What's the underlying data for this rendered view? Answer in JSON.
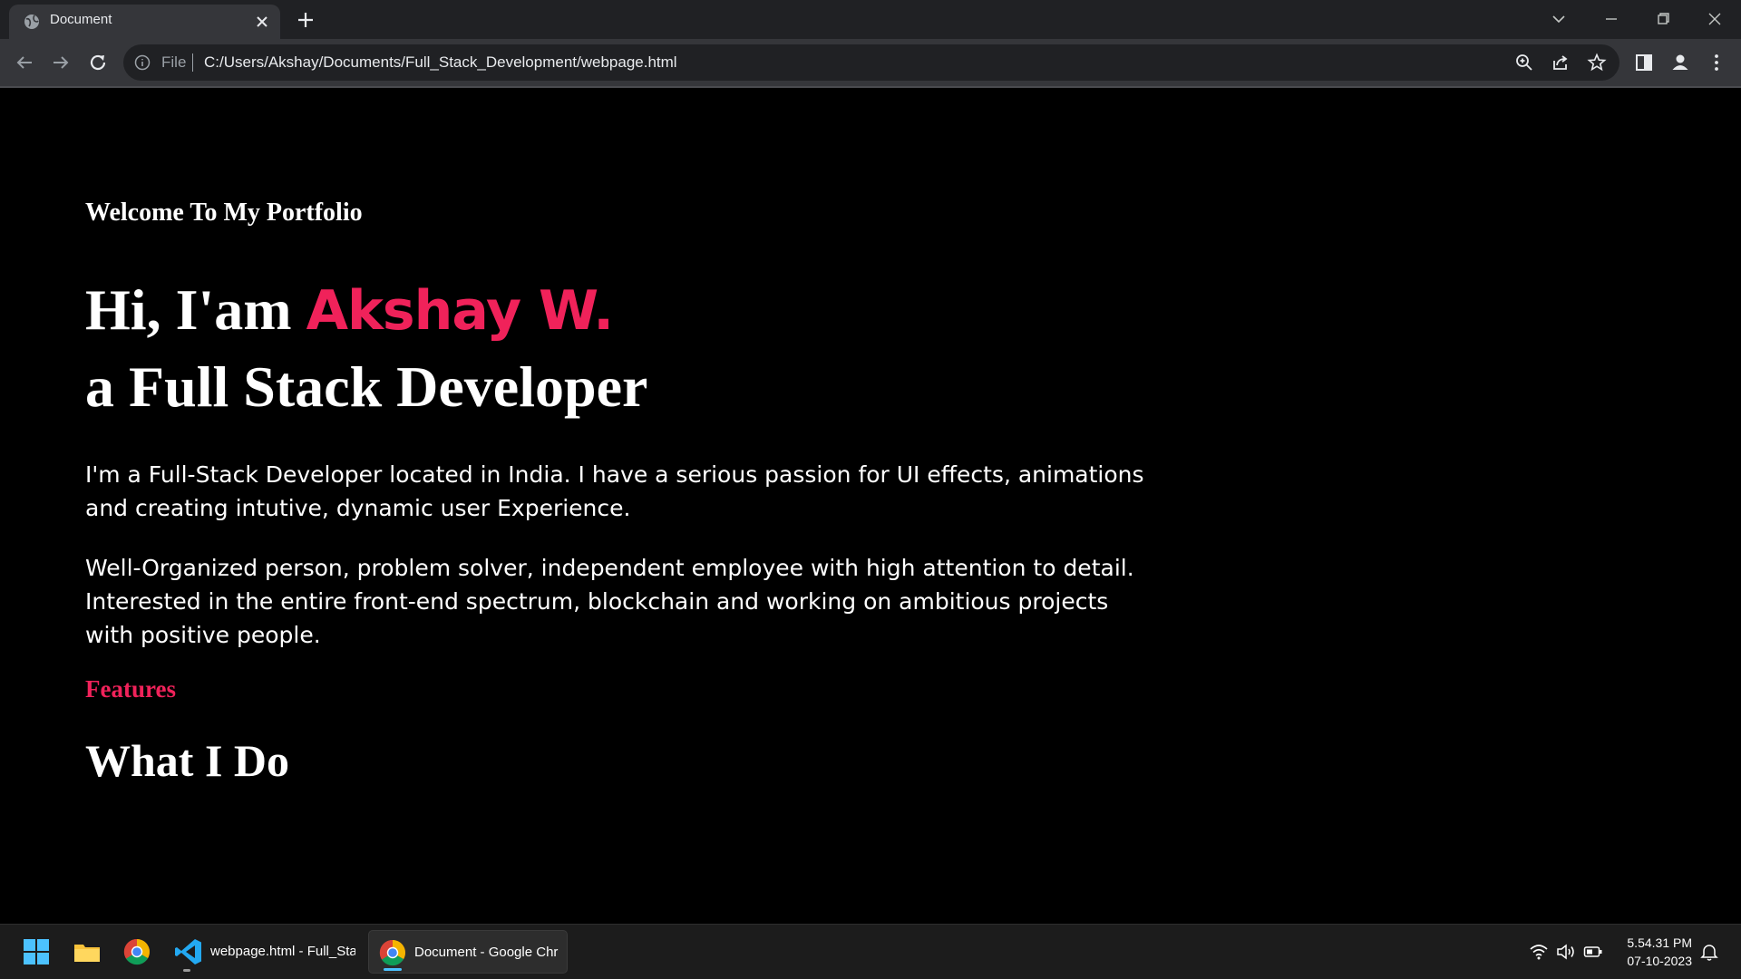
{
  "browser": {
    "tab": {
      "title": "Document"
    },
    "address": {
      "scheme_label": "File",
      "url": "C:/Users/Akshay/Documents/Full_Stack_Development/webpage.html"
    }
  },
  "page": {
    "welcome": "Welcome To My Portfolio",
    "hero_prefix": "Hi, I'am ",
    "hero_name": "Akshay W.",
    "hero_line2": "a Full Stack Developer",
    "para1": "I'm a Full-Stack Developer located in India. I have a serious passion for UI effects, animations and creating intutive, dynamic user Experience.",
    "para2": "Well-Organized person, problem solver, independent employee with high attention to detail. Interested in the entire front-end spectrum, blockchain and working on ambitious projects with positive people.",
    "features_label": "Features",
    "section_title": "What I Do",
    "accent_color": "#f0225a"
  },
  "taskbar": {
    "apps": [
      {
        "label": "webpage.html - Full_Sta",
        "icon": "vscode-icon"
      },
      {
        "label": "Document - Google Chr",
        "icon": "chrome-icon"
      }
    ],
    "clock": {
      "time": "5.54.31 PM",
      "date": "07-10-2023"
    }
  }
}
